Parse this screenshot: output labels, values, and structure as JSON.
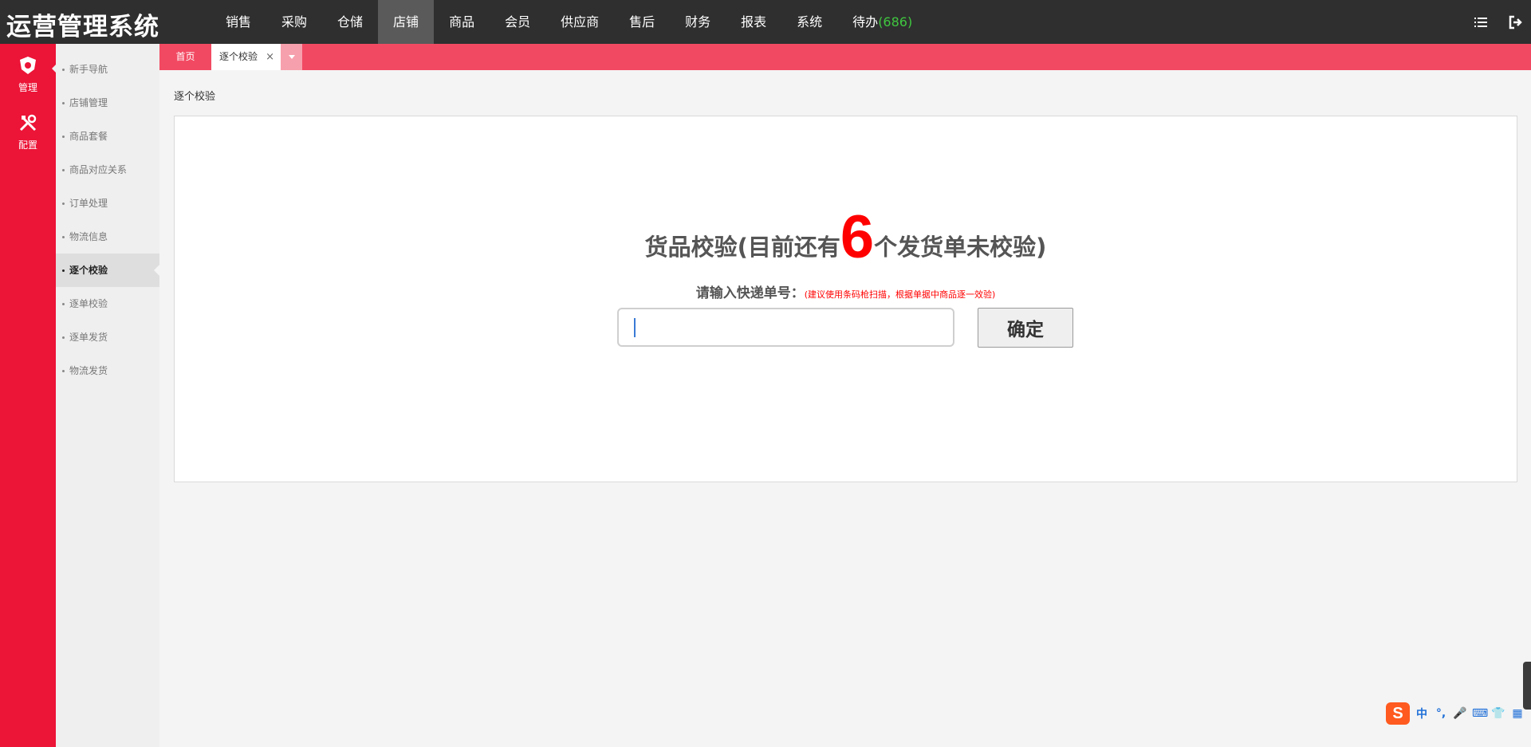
{
  "app": {
    "title": "运营管理系统"
  },
  "topnav": {
    "items": [
      "销售",
      "采购",
      "仓储",
      "店铺",
      "商品",
      "会员",
      "供应商",
      "售后",
      "财务",
      "报表",
      "系统"
    ],
    "active": "店铺",
    "todo_label": "待办",
    "todo_count": "(686)",
    "todo_count_color": "#3fc63f"
  },
  "top_icons": [
    "list-icon",
    "logout-icon"
  ],
  "rail": {
    "items": [
      {
        "label": "管理",
        "icon": "shield-icon",
        "active": true
      },
      {
        "label": "配置",
        "icon": "tools-icon",
        "active": false
      }
    ],
    "color": "#ec1437"
  },
  "sidebar": {
    "items": [
      "新手导航",
      "店铺管理",
      "商品套餐",
      "商品对应关系",
      "订单处理",
      "物流信息",
      "逐个校验",
      "逐单校验",
      "逐单发货",
      "物流发货"
    ],
    "active": "逐个校验"
  },
  "tabs": {
    "home": "首页",
    "current": "逐个校验",
    "close": "×",
    "bar_color": "#f24962"
  },
  "breadcrumb": "逐个校验",
  "main": {
    "headline_before": "货品校验(目前还有",
    "remaining_count": "6",
    "headline_after": "个发货单未校验)",
    "prompt_label": "请输入快递单号：",
    "prompt_hint": "(建议使用条码枪扫描，根据单据中商品逐一效验)",
    "input_value": "",
    "confirm_label": "确定",
    "accent": "#ff0000"
  },
  "ime": {
    "logo": "S",
    "buttons": [
      "中",
      "°,",
      "🎤",
      "⌨",
      "👕",
      "▦"
    ]
  }
}
